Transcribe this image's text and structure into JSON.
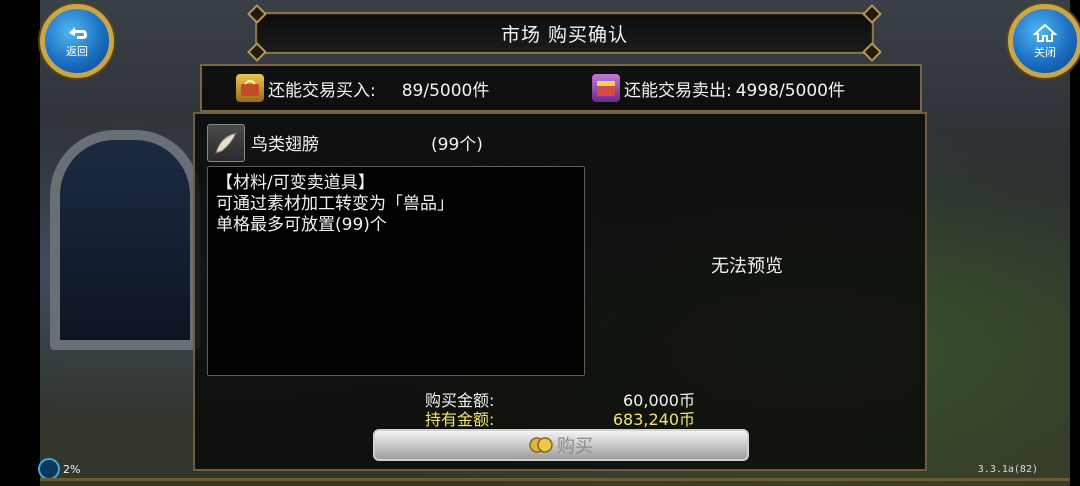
{
  "header": {
    "title": "市场  购买确认"
  },
  "nav": {
    "back_label": "返回",
    "close_label": "关闭"
  },
  "limits": {
    "buy_label": "还能交易买入:",
    "buy_value": "89/5000件",
    "sell_label": "还能交易卖出:",
    "sell_value": "4998/5000件"
  },
  "item": {
    "name": "鸟类翅膀",
    "quantity": "(99个)",
    "description": [
      "【材料/可变卖道具】",
      "可通过素材加工转变为「兽品」",
      "单格最多可放置(99)个"
    ]
  },
  "preview": {
    "text": "无法预览"
  },
  "price": {
    "purchase_label": "购买金额:",
    "purchase_value": "60,000币",
    "owned_label": "持有金额:",
    "owned_value": "683,240币"
  },
  "buy_button": {
    "label": "购买"
  },
  "status": {
    "battery": "2%",
    "version": "3.3.1a(82)"
  },
  "colors": {
    "owned_text": "#f2e26a",
    "frame_gold": "#c7a64c",
    "button_blue": "#1c6fc4"
  }
}
